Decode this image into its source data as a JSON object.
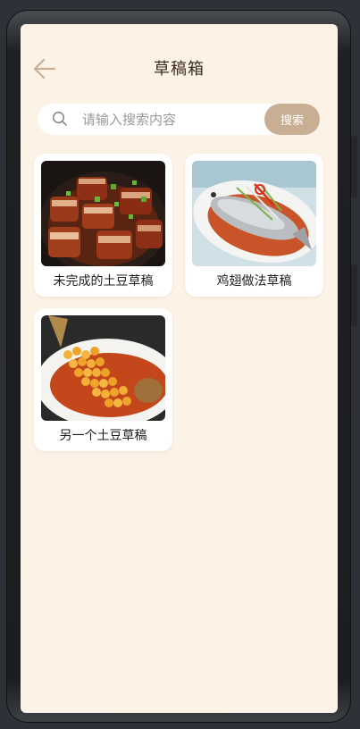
{
  "header": {
    "title": "草稿箱",
    "back_icon": "arrow-left-icon"
  },
  "search": {
    "placeholder": "请输入搜索内容",
    "value": "",
    "button_label": "搜索",
    "icon": "search-icon"
  },
  "colors": {
    "background": "#fdf2e6",
    "accent": "#c8af94",
    "card": "#ffffff"
  },
  "drafts": [
    {
      "name": "未完成的土豆草稿",
      "image": "braised-pork-photo"
    },
    {
      "name": "鸡翅做法草稿",
      "image": "steamed-fish-photo"
    },
    {
      "name": "另一个土豆草稿",
      "image": "squirrel-fish-photo"
    }
  ]
}
